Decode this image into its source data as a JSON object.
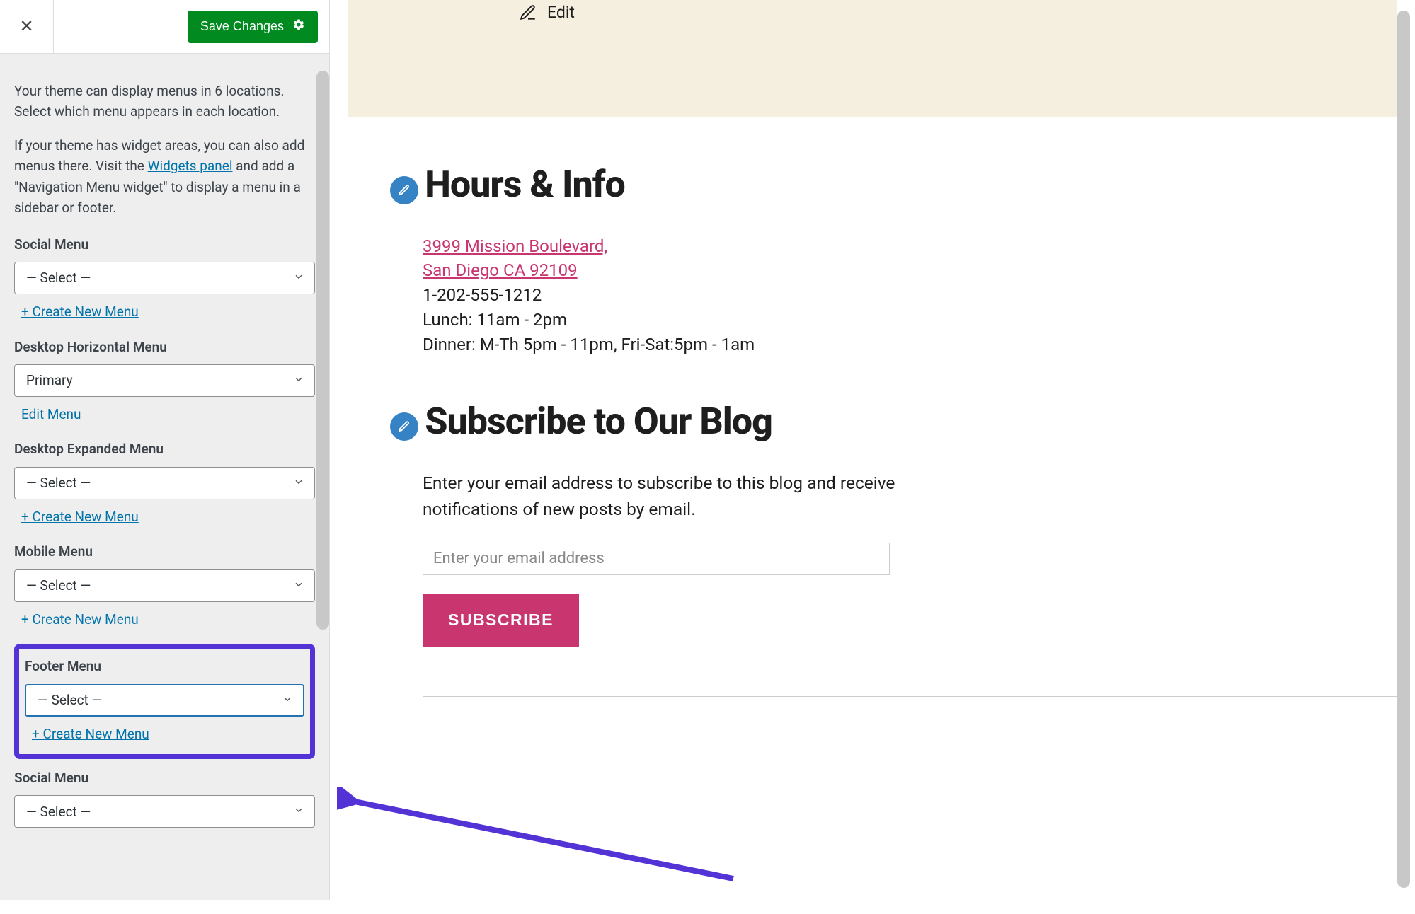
{
  "header": {
    "save_label": "Save Changes"
  },
  "intro": {
    "p1": "Your theme can display menus in 6 locations. Select which menu appears in each location.",
    "p2_pre": "If your theme has widget areas, you can also add menus there. Visit the ",
    "widgets_link": "Widgets panel",
    "p2_post": " and add a \"Navigation Menu widget\" to display a menu in a sidebar or footer."
  },
  "select_placeholder": "— Select —",
  "create_label": "+ Create New Menu",
  "edit_label": "Edit Menu",
  "menus": [
    {
      "label": "Social Menu",
      "value": "— Select —",
      "action": "create"
    },
    {
      "label": "Desktop Horizontal Menu",
      "value": "Primary",
      "action": "edit"
    },
    {
      "label": "Desktop Expanded Menu",
      "value": "— Select —",
      "action": "create"
    },
    {
      "label": "Mobile Menu",
      "value": "— Select —",
      "action": "create"
    },
    {
      "label": "Footer Menu",
      "value": "— Select —",
      "action": "create",
      "highlight": true
    },
    {
      "label": "Social Menu",
      "value": "— Select —",
      "action": "create"
    }
  ],
  "preview": {
    "edit_label": "Edit",
    "hours_heading": "Hours & Info",
    "address_line1": "3999 Mission Boulevard,",
    "address_line2": "San Diego CA 92109",
    "phone": "1-202-555-1212",
    "lunch": "Lunch: 11am - 2pm",
    "dinner": "Dinner: M-Th 5pm - 11pm, Fri-Sat:5pm - 1am",
    "subscribe_heading": "Subscribe to Our Blog",
    "subscribe_desc": "Enter your email address to subscribe to this blog and receive notifications of new posts by email.",
    "email_placeholder": "Enter your email address",
    "subscribe_btn": "SUBSCRIBE"
  }
}
